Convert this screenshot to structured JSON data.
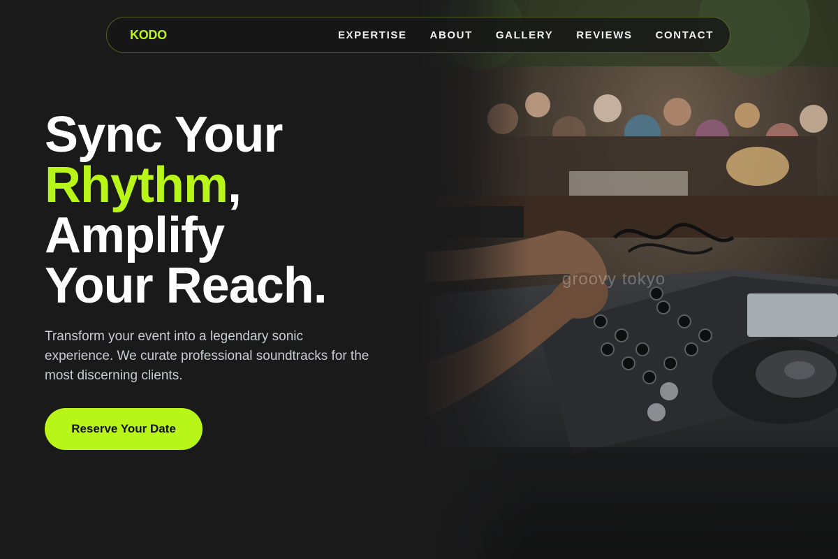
{
  "brand": {
    "logo": "KODO",
    "accent_color": "#b8f518"
  },
  "nav": {
    "items": [
      {
        "label": "EXPERTISE"
      },
      {
        "label": "ABOUT"
      },
      {
        "label": "GALLERY"
      },
      {
        "label": "REVIEWS"
      },
      {
        "label": "CONTACT"
      }
    ]
  },
  "hero": {
    "headline_line1": "Sync Your",
    "headline_accent": "Rhythm",
    "headline_comma": ",",
    "headline_line3": "Amplify",
    "headline_line4": "Your Reach.",
    "subcopy": "Transform your event into a legendary sonic experience. We curate professional soundtracks for the most discerning clients.",
    "cta_label": "Reserve Your Date",
    "image_watermark": "groovy tokyo"
  },
  "colors": {
    "background": "#1a1a1b",
    "text": "#ffffff",
    "subtext": "#c9ccd3"
  }
}
